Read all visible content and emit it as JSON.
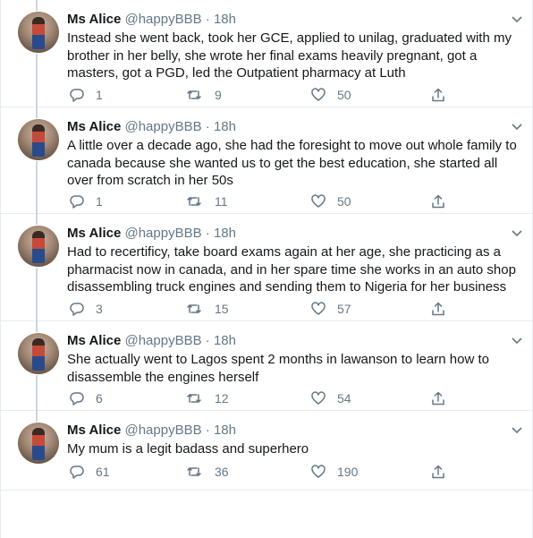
{
  "tweets": [
    {
      "name": "Ms Alice",
      "handle": "@happyBBB",
      "dot": "·",
      "time": "18h",
      "text": "Instead she went back, took her GCE, applied to unilag, graduated with my brother in her belly, she wrote her final exams heavily pregnant, got a masters, got a PGD, led the Outpatient pharmacy at Luth",
      "replies": "1",
      "retweets": "9",
      "likes": "50"
    },
    {
      "name": "Ms Alice",
      "handle": "@happyBBB",
      "dot": "·",
      "time": "18h",
      "text": "A little over a decade ago, she had the foresight to move out whole family to canada because she wanted us to get the best education, she started all over from scratch in her 50s",
      "replies": "1",
      "retweets": "11",
      "likes": "50"
    },
    {
      "name": "Ms Alice",
      "handle": "@happyBBB",
      "dot": "·",
      "time": "18h",
      "text": "Had to recertificy, take board exams again at her age, she practicing as a pharmacist now in canada, and in her spare time she works in an auto shop disassembling truck engines and sending them to Nigeria for her business",
      "replies": "3",
      "retweets": "15",
      "likes": "57"
    },
    {
      "name": "Ms Alice",
      "handle": "@happyBBB",
      "dot": "·",
      "time": "18h",
      "text": "She actually went to Lagos spent 2 months in lawanson to learn how to disassemble the engines herself",
      "replies": "6",
      "retweets": "12",
      "likes": "54"
    },
    {
      "name": "Ms Alice",
      "handle": "@happyBBB",
      "dot": "·",
      "time": "18h",
      "text": "My mum is a legit badass and superhero",
      "replies": "61",
      "retweets": "36",
      "likes": "190"
    }
  ],
  "colors": {
    "text": "#14171a",
    "muted": "#657786",
    "border": "#e6ecf0",
    "thread_line": "#ccd6dd"
  },
  "icons": [
    "reply-icon",
    "retweet-icon",
    "like-icon",
    "share-icon",
    "chevron-down-icon"
  ]
}
